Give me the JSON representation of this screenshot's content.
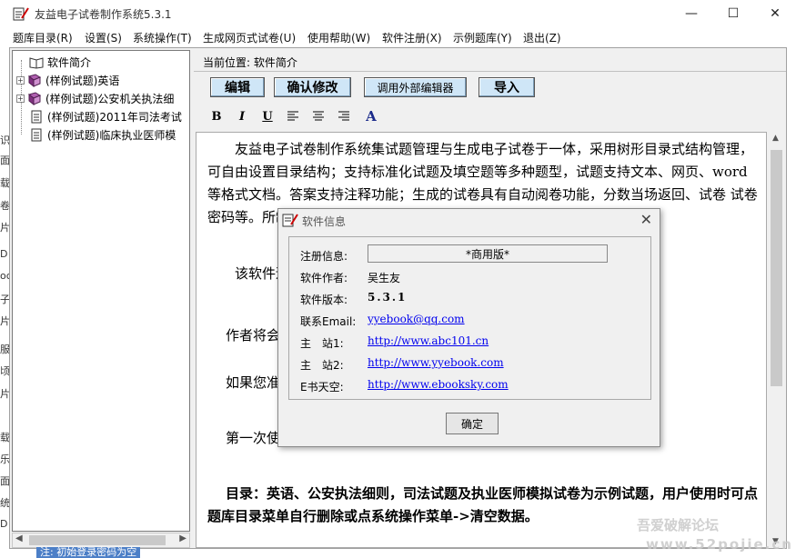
{
  "window": {
    "title": "友益电子试卷制作系统5.3.1",
    "minimize": "—",
    "maximize": "☐",
    "close": "✕"
  },
  "menu": [
    "题库目录(R)",
    "设置(S)",
    "系统操作(T)",
    "生成网页式试卷(U)",
    "使用帮助(W)",
    "软件注册(X)",
    "示例题库(Y)",
    "退出(Z)"
  ],
  "tree": [
    {
      "label": "软件简介",
      "icon": "book-open-icon",
      "expandable": false
    },
    {
      "label": "(样例试题)英语",
      "icon": "book-closed-icon",
      "expandable": true
    },
    {
      "label": "(样例试题)公安机关执法细",
      "icon": "book-closed-icon",
      "expandable": true
    },
    {
      "label": "(样例试题)2011年司法考试",
      "icon": "document-icon",
      "expandable": false
    },
    {
      "label": "(样例试题)临床执业医师模",
      "icon": "document-icon",
      "expandable": false
    }
  ],
  "location": "当前位置: 软件简介",
  "toolbar": {
    "edit": "编辑",
    "confirm": "确认修改",
    "external_editor": "调用外部编辑器",
    "import": "导入"
  },
  "format": {
    "bold": "B",
    "italic": "I",
    "underline": "U",
    "font_color": "A"
  },
  "content": {
    "p1": "友益电子试卷制作系统集试题管理与生成电子试卷于一体，采用树形目录式结构管理，可自由设置目录结构；支持标准化试题及填空题等多种题型，试题支持文本、网页、word等格式文档。答案支持注释功能；生成的试卷具有自动阅卷功能，分数当场返回、试卷                                                        试卷密码等。所制作的试                                                                 重新组卷。",
    "p2": "该软件适                                                                               训及企、事业单位的考评。",
    "p3": "作者将会                                                                         功能，不断把该软件改进成",
    "p4": "如果您准                                                                         完善该软件",
    "p5": "第一次使用请先看下使用帮助",
    "p6": "目录：英语、公安执法细则，司法试题及执业医师模拟试卷为示例试题，用户使用时可点题库目录菜单自行删除或点系统操作菜单->清空数据。"
  },
  "dialog": {
    "title": "软件信息",
    "close": "✕",
    "reg_label": "注册信息:",
    "reg_value": "*商用版*",
    "author_label": "软件作者:",
    "author_value": "吴生友",
    "version_label": "软件版本:",
    "version_value": "5.3.1",
    "email_label": "联系Email:",
    "email_value": "yyebook@qq.com",
    "site1_label": "主　站1:",
    "site1_value": "http://www.abc101.cn",
    "site2_label": "主　站2:",
    "site2_value": "http://www.yyebook.com",
    "ebook_label": "E书天空:",
    "ebook_value": "http://www.ebooksky.com",
    "ok": "确定"
  },
  "left_strip": [
    "识",
    "面",
    "载",
    "卷",
    "片",
    "D",
    "oc",
    "子",
    "片",
    "服",
    "顷",
    "片",
    "载",
    "乐",
    "面",
    "统",
    "D"
  ],
  "status": "注: 初始登录密码为空",
  "watermark": [
    "吾爱破解论坛",
    "www.52pojie.cn"
  ],
  "colors": {
    "toolbar_button": "#cfe6f7",
    "link": "#0000ee"
  }
}
